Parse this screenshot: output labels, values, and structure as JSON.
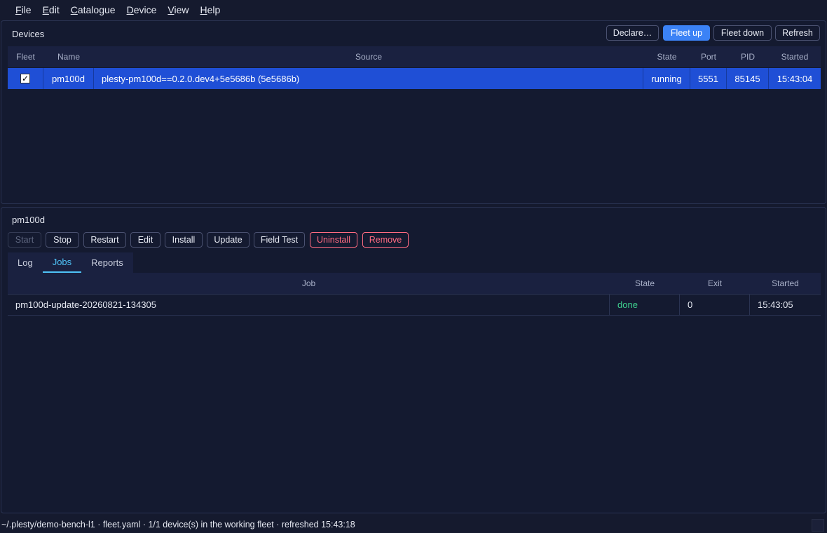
{
  "menu": [
    {
      "u": "F",
      "rest": "ile"
    },
    {
      "u": "E",
      "rest": "dit"
    },
    {
      "u": "C",
      "rest": "atalogue"
    },
    {
      "u": "D",
      "rest": "evice"
    },
    {
      "u": "V",
      "rest": "iew"
    },
    {
      "u": "H",
      "rest": "elp"
    }
  ],
  "devices": {
    "title": "Devices",
    "buttons": {
      "declare": "Declare…",
      "fleet_up": "Fleet up",
      "fleet_down": "Fleet down",
      "refresh": "Refresh"
    },
    "columns": {
      "fleet": "Fleet",
      "name": "Name",
      "source": "Source",
      "state": "State",
      "port": "Port",
      "pid": "PID",
      "started": "Started"
    },
    "rows": [
      {
        "fleet_checked": true,
        "checkmark": "✓",
        "name": "pm100d",
        "source": "plesty-pm100d==0.2.0.dev4+5e5686b (5e5686b)",
        "state": "running",
        "port": "5551",
        "pid": "85145",
        "started": "15:43:04"
      }
    ]
  },
  "detail": {
    "title": "pm100d",
    "buttons": {
      "start": "Start",
      "stop": "Stop",
      "restart": "Restart",
      "edit": "Edit",
      "install": "Install",
      "update": "Update",
      "field_test": "Field Test",
      "uninstall": "Uninstall",
      "remove": "Remove"
    },
    "tabs": {
      "log": "Log",
      "jobs": "Jobs",
      "reports": "Reports"
    },
    "active_tab": "Jobs",
    "job_columns": {
      "job": "Job",
      "state": "State",
      "exit": "Exit",
      "started": "Started"
    },
    "jobs": [
      {
        "job": "pm100d-update-20260821-134305",
        "state": "done",
        "exit": "0",
        "started": "15:43:05"
      }
    ]
  },
  "status": {
    "text": "~/.plesty/demo-bench-l1 · fleet.yaml · 1/1 device(s) in the working fleet · refreshed 15:43:18"
  },
  "colors": {
    "accent": "#3b82f6",
    "selection": "#1f4fd6",
    "danger": "#ff6b81",
    "done": "#3ecf8e",
    "tab_active": "#4fc3f7"
  }
}
